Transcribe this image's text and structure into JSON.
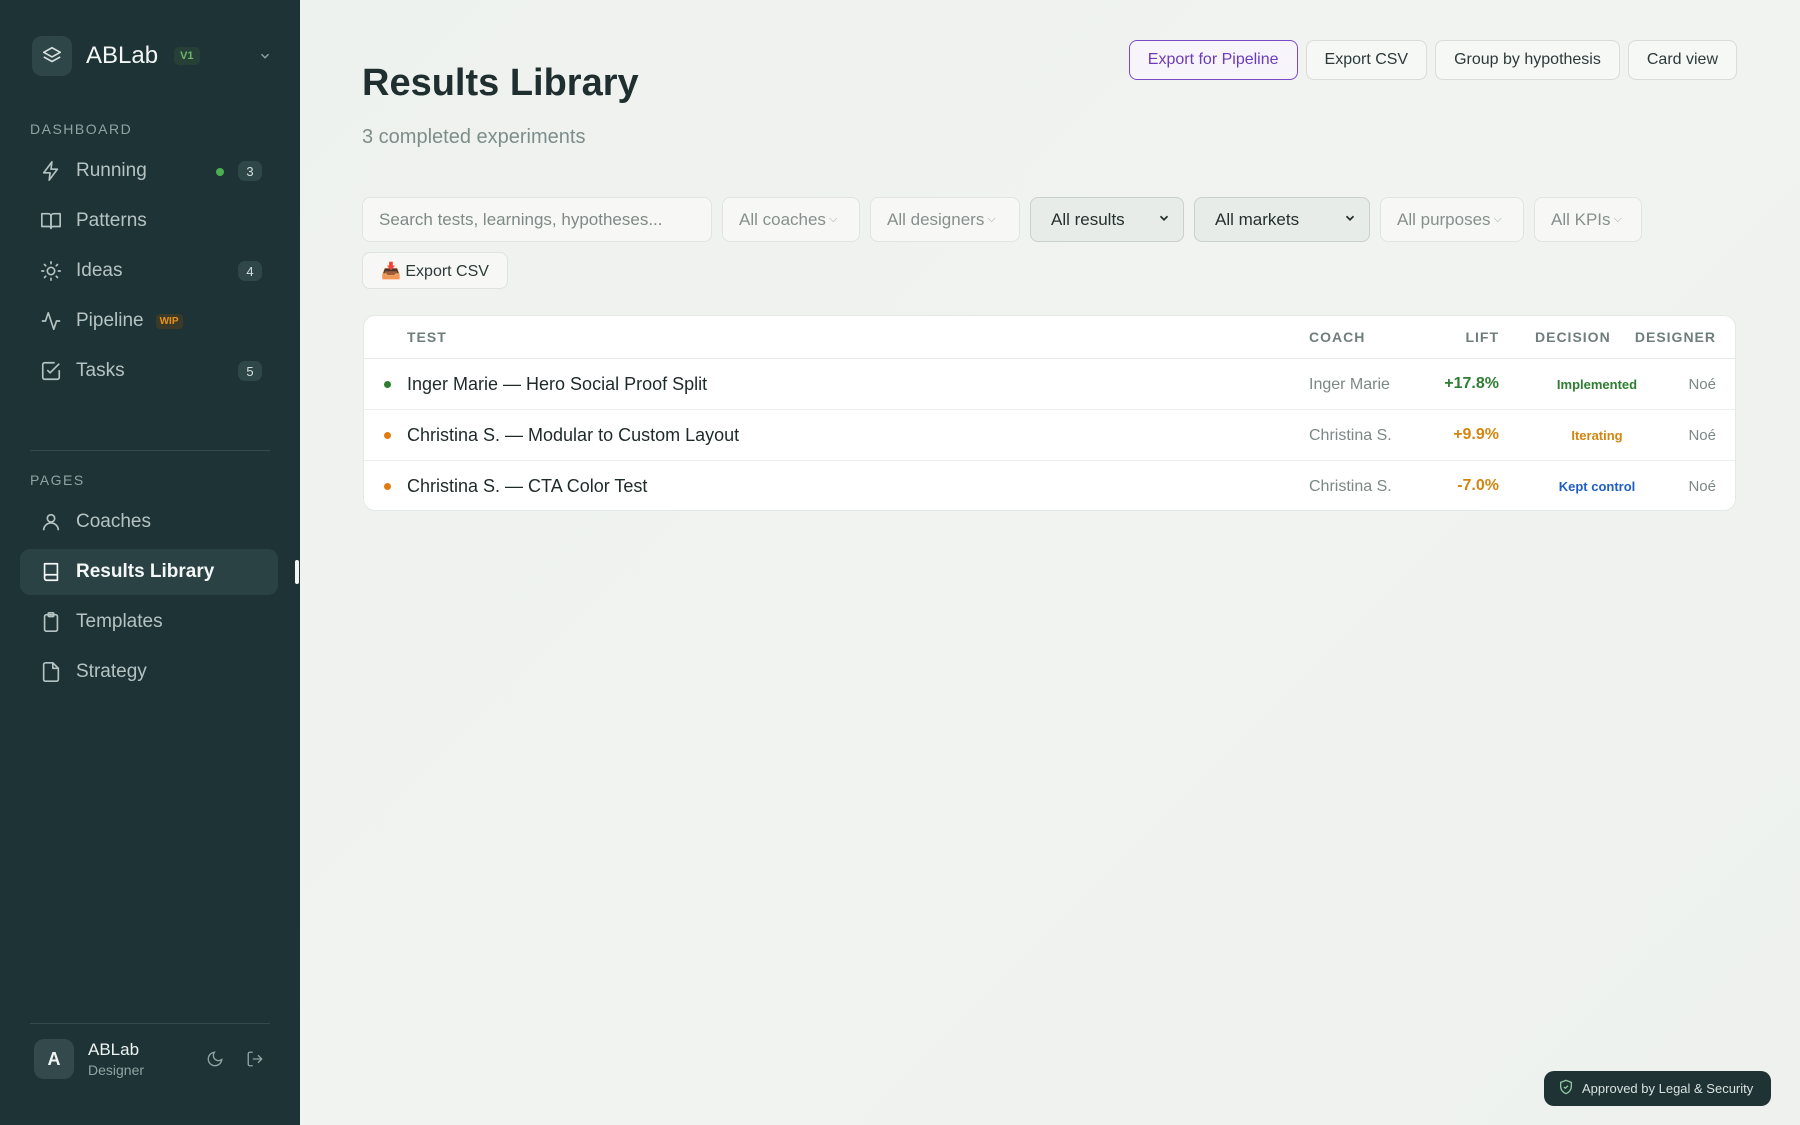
{
  "brand": {
    "name": "ABLab",
    "version": "V1"
  },
  "sidebar": {
    "sections": [
      {
        "label": "DASHBOARD"
      },
      {
        "label": "PAGES"
      }
    ],
    "dashboard_items": [
      {
        "label": "Running",
        "icon": "bolt-icon",
        "count": "3",
        "live": true
      },
      {
        "label": "Patterns",
        "icon": "book-open-icon"
      },
      {
        "label": "Ideas",
        "icon": "lightbulb-icon",
        "count": "4"
      },
      {
        "label": "Pipeline",
        "icon": "activity-icon",
        "badge": "WIP"
      },
      {
        "label": "Tasks",
        "icon": "checkbox-icon",
        "count": "5"
      }
    ],
    "page_items": [
      {
        "label": "Coaches",
        "icon": "user-icon"
      },
      {
        "label": "Results Library",
        "icon": "book-icon",
        "active": true
      },
      {
        "label": "Templates",
        "icon": "clipboard-icon"
      },
      {
        "label": "Strategy",
        "icon": "file-icon"
      }
    ],
    "user": {
      "initial": "A",
      "name": "ABLab",
      "role": "Designer"
    }
  },
  "header": {
    "title": "Results Library",
    "subtitle": "3 completed experiments",
    "actions": [
      "Export for Pipeline",
      "Export CSV",
      "Group by hypothesis",
      "Card view"
    ]
  },
  "filters": {
    "search_placeholder": "Search tests, learnings, hypotheses...",
    "coaches": "All coaches",
    "designers": "All designers",
    "results": "All results",
    "markets": "All markets",
    "purposes": "All purposes",
    "kpis": "All KPIs",
    "export_label": "📥 Export CSV"
  },
  "table": {
    "columns": {
      "test": "TEST",
      "coach": "COACH",
      "lift": "LIFT",
      "decision": "DECISION",
      "designer": "DESIGNER"
    },
    "rows": [
      {
        "test": "Inger Marie — Hero Social Proof Split",
        "coach": "Inger Marie",
        "lift": "+17.8%",
        "decision": "Implemented",
        "designer": "Noé"
      },
      {
        "test": "Christina S. — Modular to Custom Layout",
        "coach": "Christina S.",
        "lift": "+9.9%",
        "decision": "Iterating",
        "designer": "Noé"
      },
      {
        "test": "Christina S. — CTA Color Test",
        "coach": "Christina S.",
        "lift": "-7.0%",
        "decision": "Kept control",
        "designer": "Noé"
      }
    ]
  },
  "colors": {
    "sidebar_bg": "#1e3335",
    "accent_purple": "#6b3bb9",
    "implemented": "#2e7d32",
    "iterating": "#d4850f",
    "kept_control": "#1f5fc4"
  },
  "footer_badge": "Approved by Legal & Security"
}
